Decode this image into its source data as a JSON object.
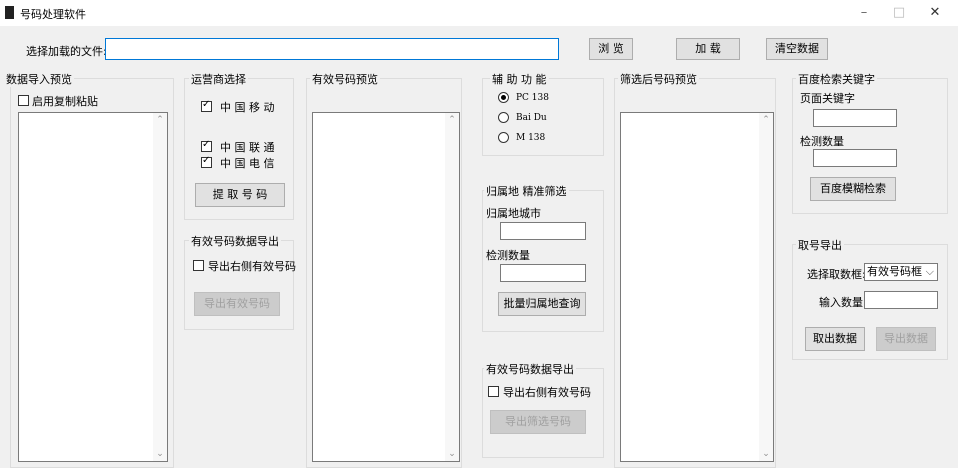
{
  "window": {
    "title": "号码处理软件",
    "minimize": "–",
    "maximize": "□",
    "close": "✕"
  },
  "file_bar": {
    "label": "选择加载的文件:",
    "value": "",
    "browse": "浏 览",
    "load": "加 载",
    "clear": "清空数据"
  },
  "import_panel": {
    "title": "数据导入预览",
    "enable_paste": "启用复制粘贴"
  },
  "carrier_panel": {
    "title": "运营商选择",
    "options": [
      {
        "label": "中 国 移 动",
        "checked": true
      },
      {
        "label": "中 国 联 通",
        "checked": true
      },
      {
        "label": "中 国 电 信",
        "checked": true
      }
    ],
    "extract_button": "提 取 号 码"
  },
  "valid_export": {
    "title": "有效号码数据导出",
    "checkbox": "导出右侧有效号码",
    "button": "导出有效号码"
  },
  "valid_preview": {
    "title": "有效号码预览"
  },
  "aux_panel": {
    "title": "辅 助 功 能",
    "options": [
      {
        "label": "PC 138",
        "selected": true
      },
      {
        "label": "Bai Du",
        "selected": false
      },
      {
        "label": "M 138",
        "selected": false
      }
    ]
  },
  "region_panel": {
    "title": "归属地  精准筛选",
    "city_label": "归属地城市",
    "count_label": "检测数量",
    "button": "批量归属地查询"
  },
  "filtered_export": {
    "title": "有效号码数据导出",
    "checkbox": "导出右侧有效号码",
    "button": "导出筛选号码"
  },
  "filtered_preview": {
    "title": "筛选后号码预览"
  },
  "baidu_panel": {
    "title": "百度检索关键字",
    "keyword_label": "页面关键字",
    "count_label": "检测数量",
    "button": "百度模糊检索"
  },
  "fetch_panel": {
    "title": "取号导出",
    "select_label": "选择取数框:",
    "select_value": "有效号码框",
    "count_label": "输入数量:",
    "fetch_button": "取出数据",
    "export_button": "导出数据"
  }
}
